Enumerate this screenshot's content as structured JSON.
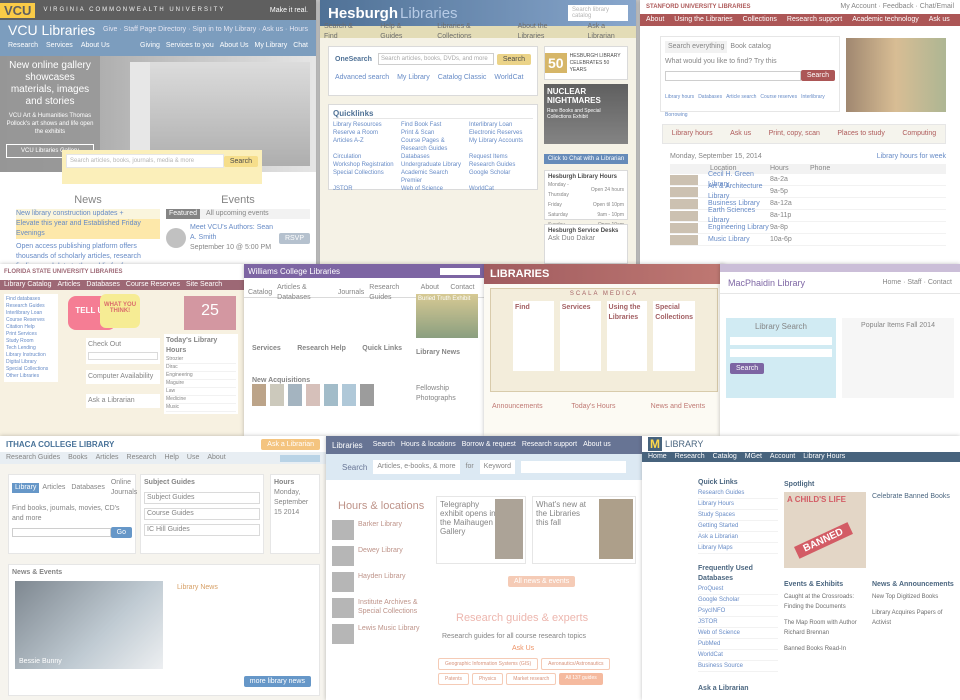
{
  "vcu": {
    "logo": "VCU",
    "university": "VIRGINIA COMMONWEALTH UNIVERSITY",
    "make_it_real": "Make it real.",
    "title": "VCU Libraries",
    "top_links": [
      "Give",
      "Staff Page Directory",
      "Sign in to My Library",
      "Ask us",
      "Hours"
    ],
    "nav": [
      "Research",
      "Services",
      "About Us"
    ],
    "nav_right": [
      "Giving",
      "Services to you",
      "About Us",
      "My Library",
      "Chat"
    ],
    "hero_text": "New online gallery showcases materials, images and stories",
    "hero_sub": "VCU Art & Humanities Thomas Pollock's art shows and life open the exhibits",
    "hero_btn": "VCU Libraries Gallery",
    "search_placeholder": "Search articles, books, journals, media & more",
    "search_btn": "Search",
    "news_title": "News",
    "events_title": "Events",
    "news_items": [
      "New library construction updates +",
      "Elevate this year and Established Friday Evenings",
      "Open access publishing platform offers thousands of scholarly articles, research findings and data to the public for free"
    ],
    "events_featured": "Featured",
    "events_all": "All upcoming events",
    "event_title": "Meet VCU's Authors: Sean A. Smith",
    "event_date": "September 10 @ 5:00 PM",
    "event_btn": "RSVP"
  },
  "hesburgh": {
    "title": "Hesburgh",
    "title2": "Libraries",
    "search_placeholder": "Search library catalog",
    "nav": [
      "Search & Find",
      "Help & Guides",
      "Libraries & Collections",
      "About the Libraries",
      "Ask a Librarian"
    ],
    "search_label": "OneSearch",
    "search_input": "Search articles, books, DVDs, and more",
    "search_btn": "Search",
    "links": [
      "Advanced search",
      "My Library",
      "Catalog Classic",
      "WorldCat"
    ],
    "quicklinks_title": "Quicklinks",
    "quicklinks": [
      "Library Resources",
      "Find Book Fast",
      "Interlibrary Loan",
      "Reserve a Room",
      "Print & Scan",
      "Electronic Reserves",
      "Articles A-Z",
      "Course Pages & Research Guides",
      "My Library Accounts",
      "Circulation",
      "Databases",
      "Request Items",
      "Workshop Registration",
      "Undergraduate Library",
      "Research Guides",
      "Special Collections",
      "Academic Search Premier",
      "Google Scholar",
      "JSTOR",
      "Web of Science",
      "WorldCat"
    ],
    "ad_number": "50",
    "ad_text": "HESBURGH LIBRARY CELEBRATES 50 YEARS",
    "nightmares": "NUCLEAR NIGHTMARES",
    "nightmares_sub": "Rare Books and Special Collections Exhibit",
    "chat": "Click to Chat with a Librarian",
    "hours_title": "Hesburgh Library Hours",
    "hours": [
      "Monday - Thursday",
      "Friday",
      "Saturday",
      "Sunday"
    ],
    "hours_vals": [
      "Open 24 hours",
      "Open til 10pm",
      "9am - 10pm",
      "Open 10am"
    ],
    "service_title": "Hesburgh Service Desks",
    "service_sub": "Ask Duo Dakar"
  },
  "stanford": {
    "univ": "STANFORD UNIVERSITY LIBRARIES",
    "top": [
      "My Account",
      "Feedback",
      "Chat/Email"
    ],
    "nav": [
      "About",
      "Using the Libraries",
      "Collections",
      "Research support",
      "Academic technology",
      "Ask us"
    ],
    "tabs": [
      "Search everything",
      "Book catalog"
    ],
    "search_q": "What would you like to find? Try this",
    "search_btn": "Search",
    "quick": [
      "Library hours",
      "Databases",
      "Article search",
      "Course reserves",
      "Interlibrary Borrowing"
    ],
    "services": [
      "Library hours",
      "Ask us",
      "Print, copy, scan",
      "Places to study",
      "Computing"
    ],
    "table_title": "Monday, September 15, 2014",
    "table_link": "Library hours for week",
    "table_headers": [
      "Location",
      "Hours",
      "Phone"
    ],
    "libraries": [
      "Cecil H. Green Library",
      "Art & Architecture Library",
      "Business Library",
      "Earth Sciences Library",
      "Engineering Library",
      "Music Library"
    ],
    "hours_vals": [
      "8a-2a",
      "9a-5p",
      "8a-12a",
      "8a-11p",
      "9a-8p",
      "10a-6p"
    ]
  },
  "fsu": {
    "title": "FLORIDA STATE UNIVERSITY LIBRARIES",
    "tabs": [
      "Library Catalog",
      "Articles",
      "Databases",
      "Course Reserves",
      "Site Search"
    ],
    "tell_us": "TELL US",
    "what_you_think": "WHAT YOU THINK!",
    "num": "25",
    "ask_title": "Ask a Librarian",
    "checkout_title": "Check Out",
    "list": [
      "Find databases",
      "Research Guides",
      "Interlibrary Loan",
      "Course Reserves",
      "Citation Help",
      "Print Services",
      "Study Room",
      "Tech Lending",
      "Library Instruction",
      "Digital Library",
      "Special Collections",
      "Other Libraries"
    ],
    "hours_title": "Today's Library Hours",
    "hours_rows": [
      "Strozier",
      "Dirac",
      "Engineering",
      "Maguire",
      "Law",
      "Medicine",
      "Music"
    ],
    "computer_avail": "Computer Availability"
  },
  "williams": {
    "title": "Williams College Libraries",
    "tabs": [
      "Catalog",
      "Articles & Databases",
      "Journals",
      "Research Guides",
      "About Us",
      "Contact Us"
    ],
    "sections": [
      "Services",
      "Research Help",
      "Quick Links"
    ],
    "highlights": "New Acquisitions",
    "featured": "Buried Truth Exhibit",
    "news": "Library News",
    "feature_photo": "Fellowship Photographs"
  },
  "scala": {
    "title": "LIBRARIES",
    "subtitle": "SCALA MEDICA",
    "headers": [
      "Find",
      "Services",
      "Using the Libraries",
      "Special Collections"
    ],
    "announce": "Announcements",
    "today": "Today's Hours",
    "news": "News and Events"
  },
  "macphaidin": {
    "title": "MacPhaidin Library",
    "links": [
      "Home",
      "Staff",
      "Contact"
    ],
    "search_title": "Library Search",
    "popular_title": "Popular Items Fall 2014",
    "search_btn": "Search"
  },
  "ithaca": {
    "title": "ITHACA COLLEGE LIBRARY",
    "ask_btn": "Ask a Librarian",
    "nav": [
      "Research Guides",
      "Books",
      "Articles",
      "Research",
      "Help",
      "Use",
      "About"
    ],
    "tabs": [
      "Library",
      "Articles",
      "Databases",
      "Online Journals"
    ],
    "search_label": "Find books, journals, movies, CD's and more",
    "go_btn": "Go",
    "subject_title": "Subject Guides",
    "guides": [
      "Subject Guides",
      "Course Guides",
      "IC Hill Guides"
    ],
    "hours_title": "Hours",
    "hours_today": "Monday, September 15 2014",
    "news_title": "News & Events",
    "library_news": "Library News",
    "caption": "Bessie Bunny",
    "more_btn": "more library news"
  },
  "pitt": {
    "logo": "Libraries",
    "nav": [
      "Search",
      "Hours & locations",
      "Borrow & request",
      "Research support",
      "About us"
    ],
    "icons": [
      "Ask",
      "Library",
      "Account"
    ],
    "search_label": "Search",
    "search_options": "Articles, e-books, & more",
    "in_label": "for",
    "keyword": "Keyword",
    "hours_title": "Hours & locations",
    "locations": [
      "Barker Library",
      "Dewey Library",
      "Hayden Library",
      "Institute Archives & Special Collections",
      "Lewis Music Library"
    ],
    "news_left": "Telegraphy exhibit opens in the Maihaugen Gallery",
    "news_right": "What's new at the Libraries this fall",
    "news_btn": "All news & events",
    "guides_title": "Research guides & experts",
    "guides_text": "Research guides for all course research topics",
    "guides_tags": [
      "Geographic Information Systems (GIS)",
      "Aeronautics/Astronautics",
      "Patents",
      "Physics",
      "Market research",
      "All 137 guides"
    ],
    "ask_us": "Ask Us"
  },
  "michigan": {
    "logo": "M",
    "logo_text": "LIBRARY",
    "nav": [
      "Home",
      "Research",
      "Catalog",
      "MGet",
      "Account",
      "Library Hours"
    ],
    "quick_title": "Quick Links",
    "quick": [
      "Research Guides",
      "Library Hours",
      "Study Spaces",
      "Getting Started",
      "Ask a Librarian",
      "Library Maps"
    ],
    "db_title": "Frequently Used Databases",
    "databases": [
      "ProQuest",
      "Google Scholar",
      "PsycINFO",
      "JSTOR",
      "Web of Science",
      "PubMed",
      "WorldCat",
      "Business Source"
    ],
    "spotlight": "Spotlight",
    "book_title": "A CHILD'S LIFE",
    "banned": "BANNED",
    "spot_title": "Celebrate Banned Books",
    "events_title": "Events & Exhibits",
    "events": [
      "Caught at the Crossroads: Finding the Documents",
      "The Map Room with Author Richard Brennan",
      "Banned Books Read-In"
    ],
    "news_title": "News & Announcements",
    "news": [
      "New Top Digitized Books",
      "Library Acquires Papers of Activist"
    ],
    "ask": "Ask a Librarian"
  },
  "colors": {
    "vcu_gold": "#f8b800",
    "vcu_blue": "#4a78a6",
    "hesburgh_blue": "#0c3b6e",
    "hesburgh_gold": "#c69a2e",
    "stanford_red": "#8c1515",
    "pitt_orange": "#e6692b",
    "pitt_navy": "#2d3f6b",
    "michigan_blue": "#00274c",
    "michigan_maize": "#ffcb05"
  }
}
